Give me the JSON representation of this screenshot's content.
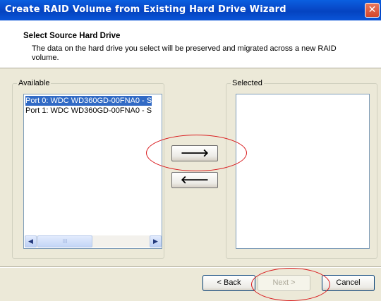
{
  "window": {
    "title": "Create RAID Volume from Existing Hard Drive Wizard",
    "close_glyph": "✕"
  },
  "header": {
    "title": "Select Source Hard Drive",
    "description": "The data on the hard drive you select will be preserved and migrated across a new RAID volume."
  },
  "available": {
    "label": "Available",
    "items": [
      {
        "text": "Port 0: WDC WD360GD-00FNA0 - S",
        "selected": true
      },
      {
        "text": "Port 1: WDC WD360GD-00FNA0 - S",
        "selected": false
      }
    ],
    "scroll_left": "◀",
    "scroll_right": "▶",
    "thumb_grip": "III"
  },
  "selected": {
    "label": "Selected",
    "items": []
  },
  "arrows": {
    "add": "🡒",
    "remove": "🡐"
  },
  "footer": {
    "back_label": "< Back",
    "next_label": "Next >",
    "cancel_label": "Cancel"
  },
  "colors": {
    "title_bar": "#0a55d8",
    "highlight_oval": "#d9191c",
    "selection": "#316ac5"
  }
}
